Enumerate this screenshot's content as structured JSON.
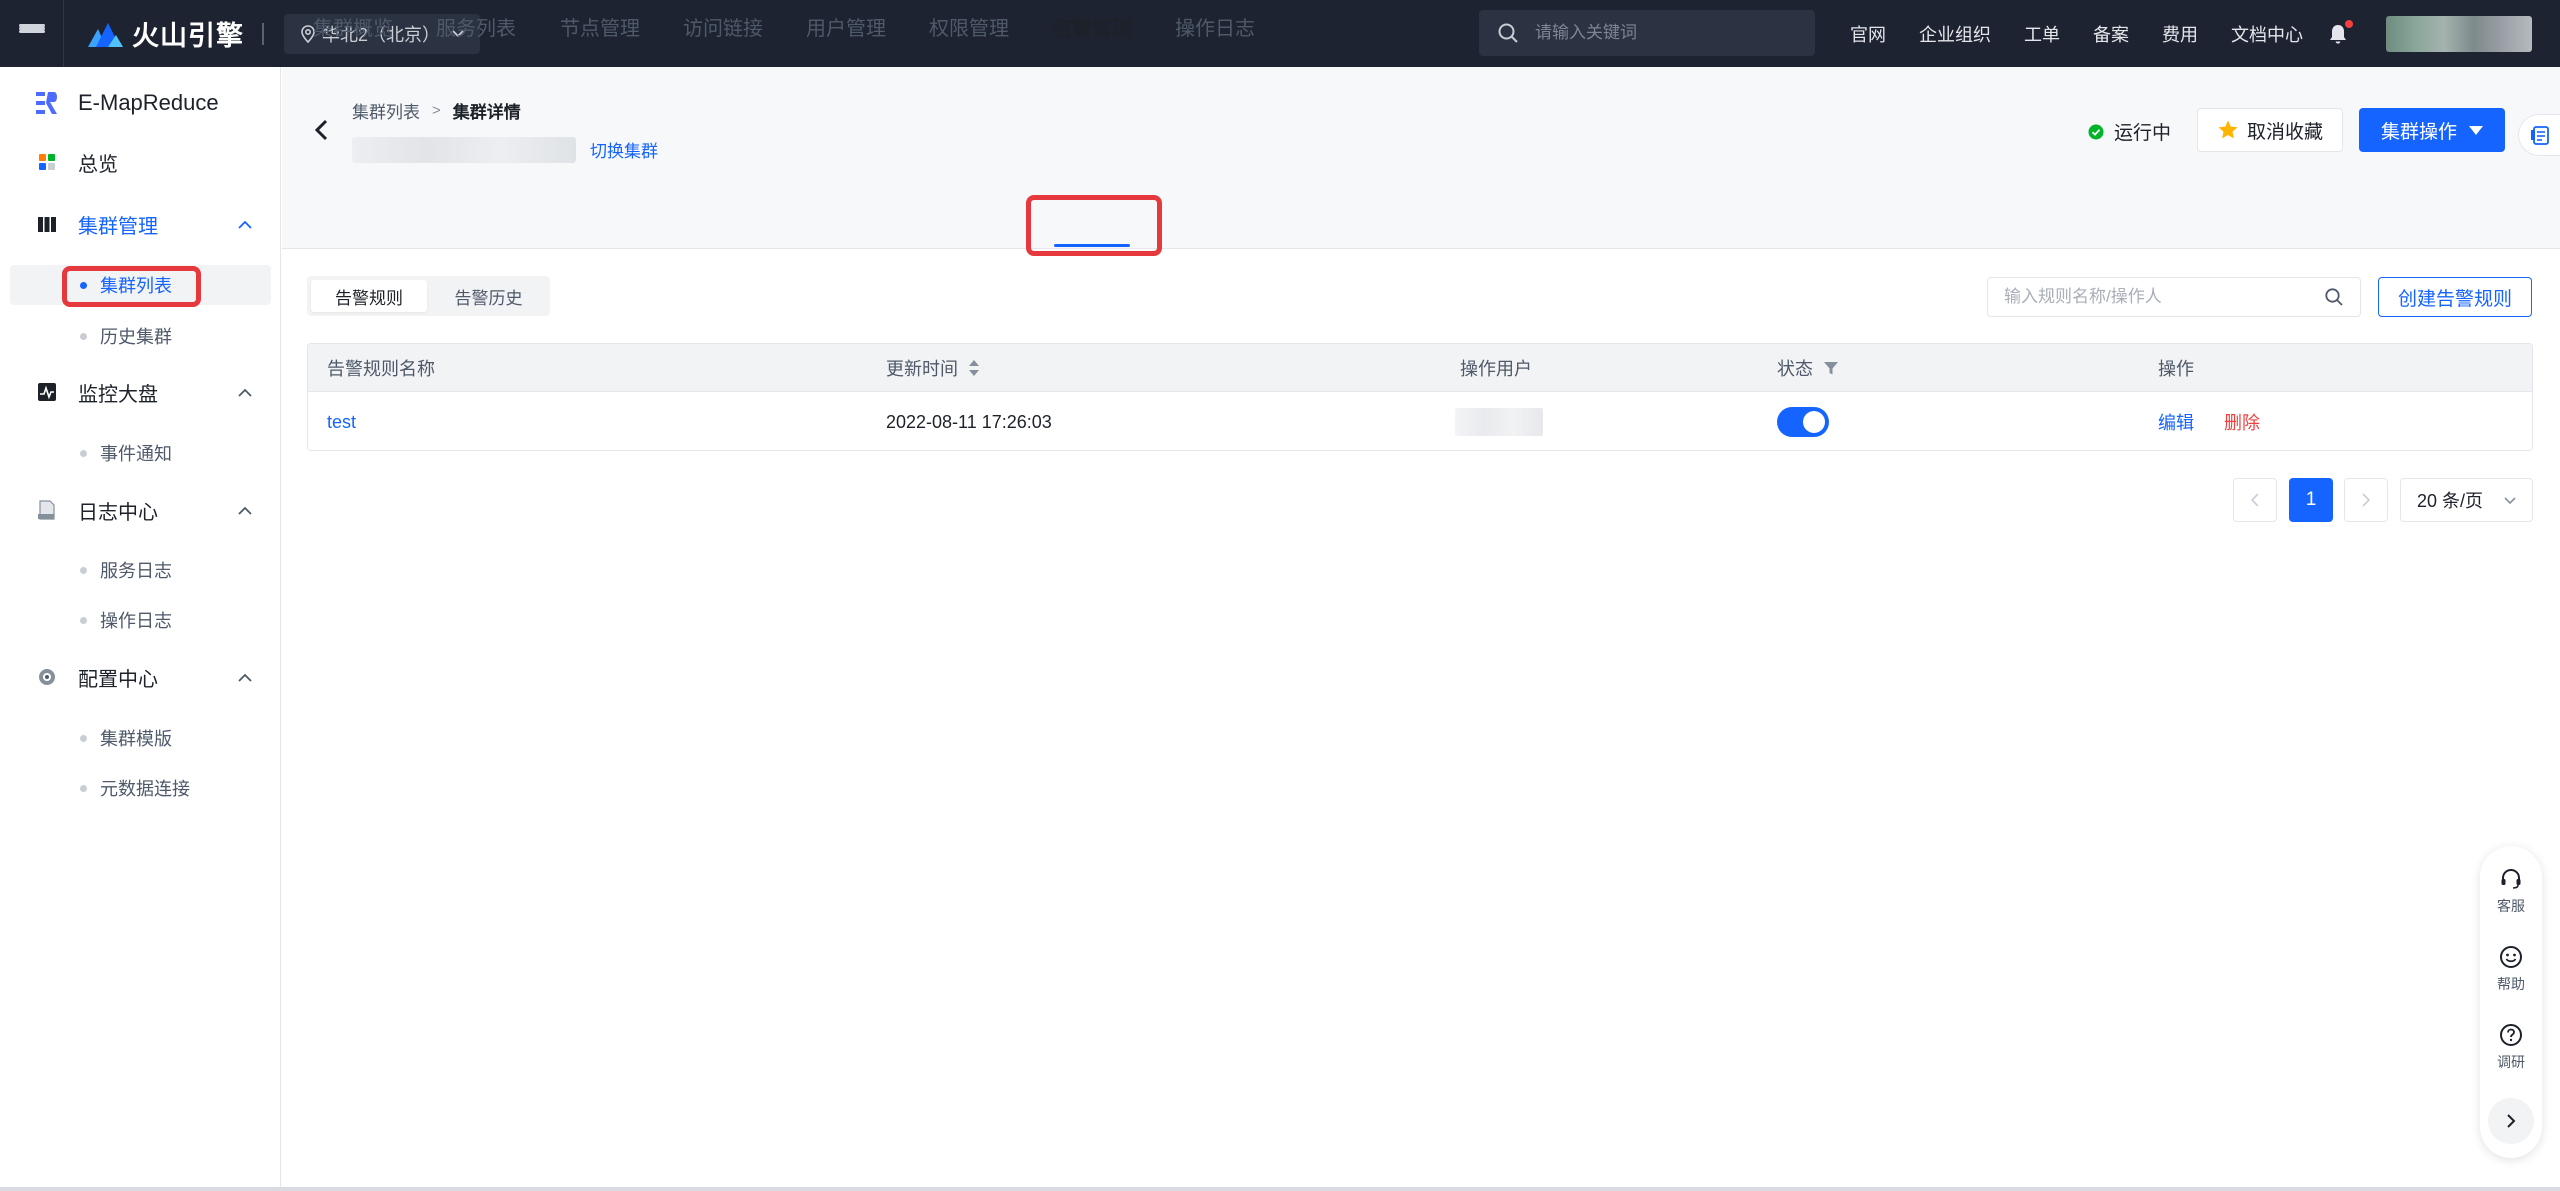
{
  "topbar": {
    "brand": "火山引擎",
    "region": "华北2（北京）",
    "search_placeholder": "请输入关键词",
    "links": [
      "官网",
      "企业组织",
      "工单",
      "备案",
      "费用",
      "文档中心"
    ],
    "icons": [
      "hamburger-icon",
      "location-pin-icon",
      "chevron-down-icon",
      "search-icon",
      "bell-icon"
    ]
  },
  "sidebar": {
    "product": "E-MapReduce",
    "items": [
      {
        "label": "总览",
        "icon": "overview-icon"
      },
      {
        "label": "集群管理",
        "icon": "cluster-icon",
        "active": true
      },
      {
        "label": "监控大盘",
        "icon": "monitor-icon"
      },
      {
        "label": "日志中心",
        "icon": "log-icon"
      },
      {
        "label": "配置中心",
        "icon": "gear-icon"
      }
    ],
    "sub": {
      "cluster": [
        "集群列表",
        "历史集群"
      ],
      "monitor": [
        "事件通知"
      ],
      "log": [
        "服务日志",
        "操作日志"
      ],
      "config": [
        "集群模版",
        "元数据连接"
      ]
    }
  },
  "header": {
    "breadcrumb": [
      "集群列表",
      "集群详情"
    ],
    "breadcrumb_sep": ">",
    "switch_cluster": "切换集群",
    "status": "运行中",
    "unfavorite": "取消收藏",
    "cluster_ops": "集群操作"
  },
  "tabs": [
    "集群概览",
    "服务列表",
    "节点管理",
    "访问链接",
    "用户管理",
    "权限管理",
    "告警管理",
    "操作日志"
  ],
  "active_tab": "告警管理",
  "content": {
    "segments": [
      "告警规则",
      "告警历史"
    ],
    "rule_search_placeholder": "输入规则名称/操作人",
    "create_rule": "创建告警规则",
    "columns": [
      "告警规则名称",
      "更新时间",
      "操作用户",
      "状态",
      "操作"
    ],
    "rows": [
      {
        "name": "test",
        "updated": "2022-08-11 17:26:03",
        "enabled": true,
        "actions": [
          "编辑",
          "删除"
        ]
      }
    ],
    "pagination": {
      "current_page": "1",
      "page_size": "20 条/页"
    }
  },
  "float_help": [
    "客服",
    "帮助",
    "调研"
  ],
  "colors": {
    "primary": "#1664ff",
    "danger": "#f53f3f",
    "highlight": "#e5393e",
    "topbar": "#1d2330"
  }
}
